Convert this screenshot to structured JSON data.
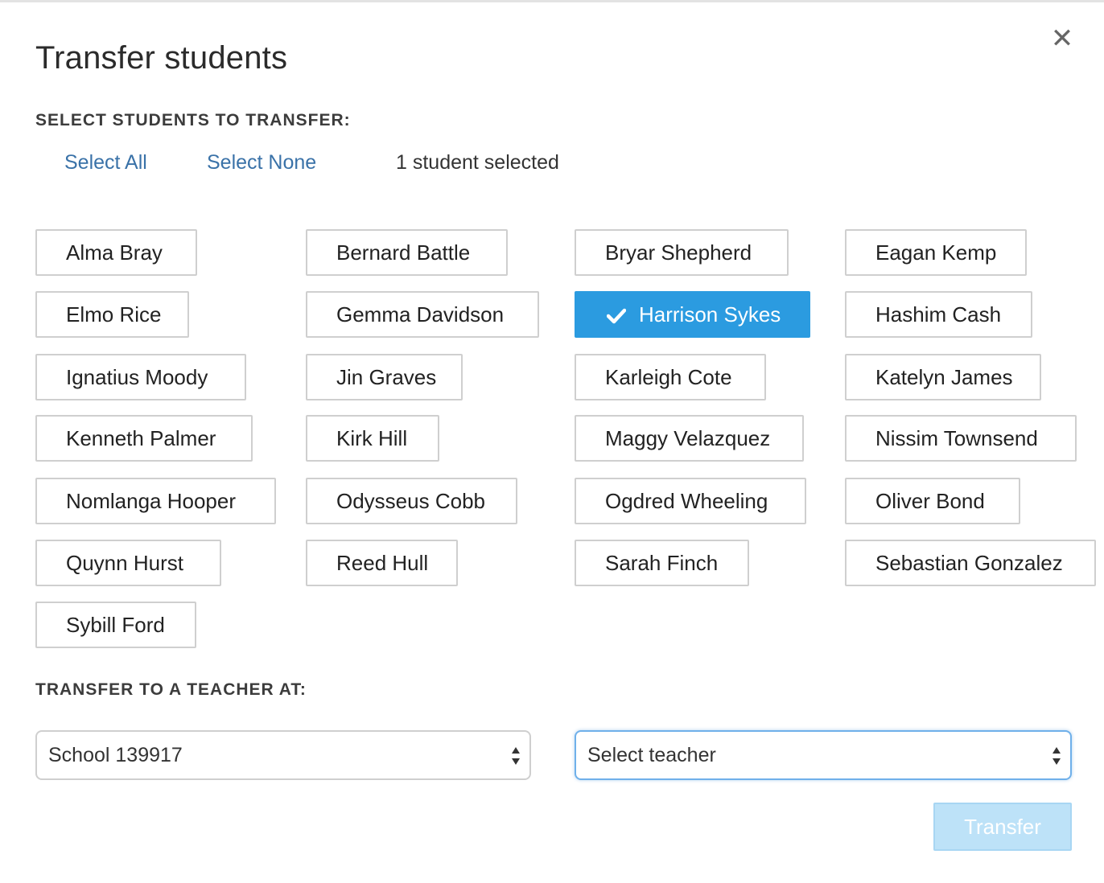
{
  "dialog": {
    "title": "Transfer students",
    "close_icon": "close-icon"
  },
  "select_section": {
    "label": "SELECT STUDENTS TO TRANSFER:",
    "select_all": "Select All",
    "select_none": "Select None",
    "selected_count": "1 student selected"
  },
  "students": [
    {
      "name": "Alma Bray",
      "selected": false
    },
    {
      "name": "Bernard Battle",
      "selected": false
    },
    {
      "name": "Bryar Shepherd",
      "selected": false
    },
    {
      "name": "Eagan Kemp",
      "selected": false
    },
    {
      "name": "Elmo Rice",
      "selected": false
    },
    {
      "name": "Gemma Davidson",
      "selected": false
    },
    {
      "name": "Harrison Sykes",
      "selected": true
    },
    {
      "name": "Hashim Cash",
      "selected": false
    },
    {
      "name": "Ignatius Moody",
      "selected": false
    },
    {
      "name": "Jin Graves",
      "selected": false
    },
    {
      "name": "Karleigh Cote",
      "selected": false
    },
    {
      "name": "Katelyn James",
      "selected": false
    },
    {
      "name": "Kenneth Palmer",
      "selected": false
    },
    {
      "name": "Kirk Hill",
      "selected": false
    },
    {
      "name": "Maggy Velazquez",
      "selected": false
    },
    {
      "name": "Nissim Townsend",
      "selected": false
    },
    {
      "name": "Nomlanga Hooper",
      "selected": false
    },
    {
      "name": "Odysseus Cobb",
      "selected": false
    },
    {
      "name": "Ogdred Wheeling",
      "selected": false
    },
    {
      "name": "Oliver Bond",
      "selected": false
    },
    {
      "name": "Quynn Hurst",
      "selected": false
    },
    {
      "name": "Reed Hull",
      "selected": false
    },
    {
      "name": "Sarah Finch",
      "selected": false
    },
    {
      "name": "Sebastian Gonzalez",
      "selected": false
    },
    {
      "name": "Sybill Ford",
      "selected": false
    }
  ],
  "transfer_section": {
    "label": "TRANSFER TO A TEACHER AT:",
    "school_value": "School 139917",
    "teacher_placeholder": "Select teacher",
    "transfer_button": "Transfer"
  },
  "colors": {
    "selected_bg": "#2b9be0",
    "link": "#3a72a8",
    "transfer_disabled": "#bde2f8"
  }
}
